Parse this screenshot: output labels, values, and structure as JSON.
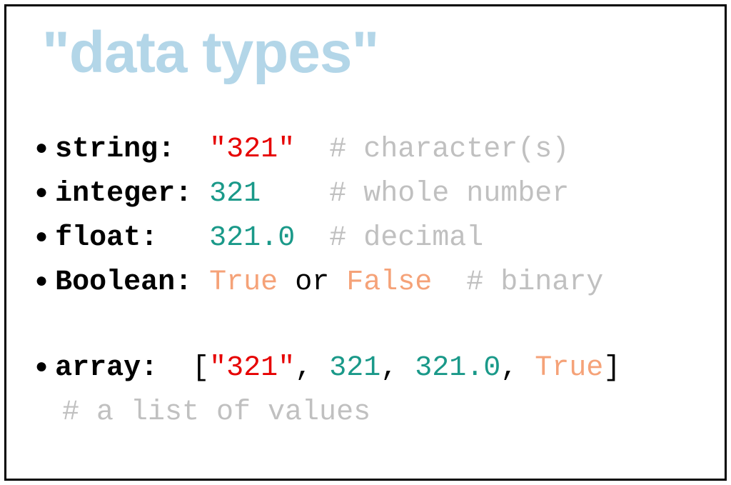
{
  "title": "\"data types\"",
  "rows": {
    "string": {
      "label": "string:  ",
      "value": "\"321\"",
      "pad": "  ",
      "comment": "# character(s)"
    },
    "integer": {
      "label": "integer: ",
      "value": "321",
      "pad": "    ",
      "comment": "# whole number"
    },
    "float": {
      "label": "float:   ",
      "value": "321.0",
      "pad": "  ",
      "comment": "# decimal"
    },
    "boolean": {
      "label": "Boolean: ",
      "true_val": "True",
      "or_text": " or ",
      "false_val": "False",
      "pad": "  ",
      "comment": "# binary"
    },
    "array": {
      "label": "array:  ",
      "open": "[",
      "item1": "\"321\"",
      "sep1": ", ",
      "item2": "321",
      "sep2": ", ",
      "item3": "321.0",
      "sep3": ", ",
      "item4": "True",
      "close": "]",
      "comment": "# a list of values"
    }
  }
}
